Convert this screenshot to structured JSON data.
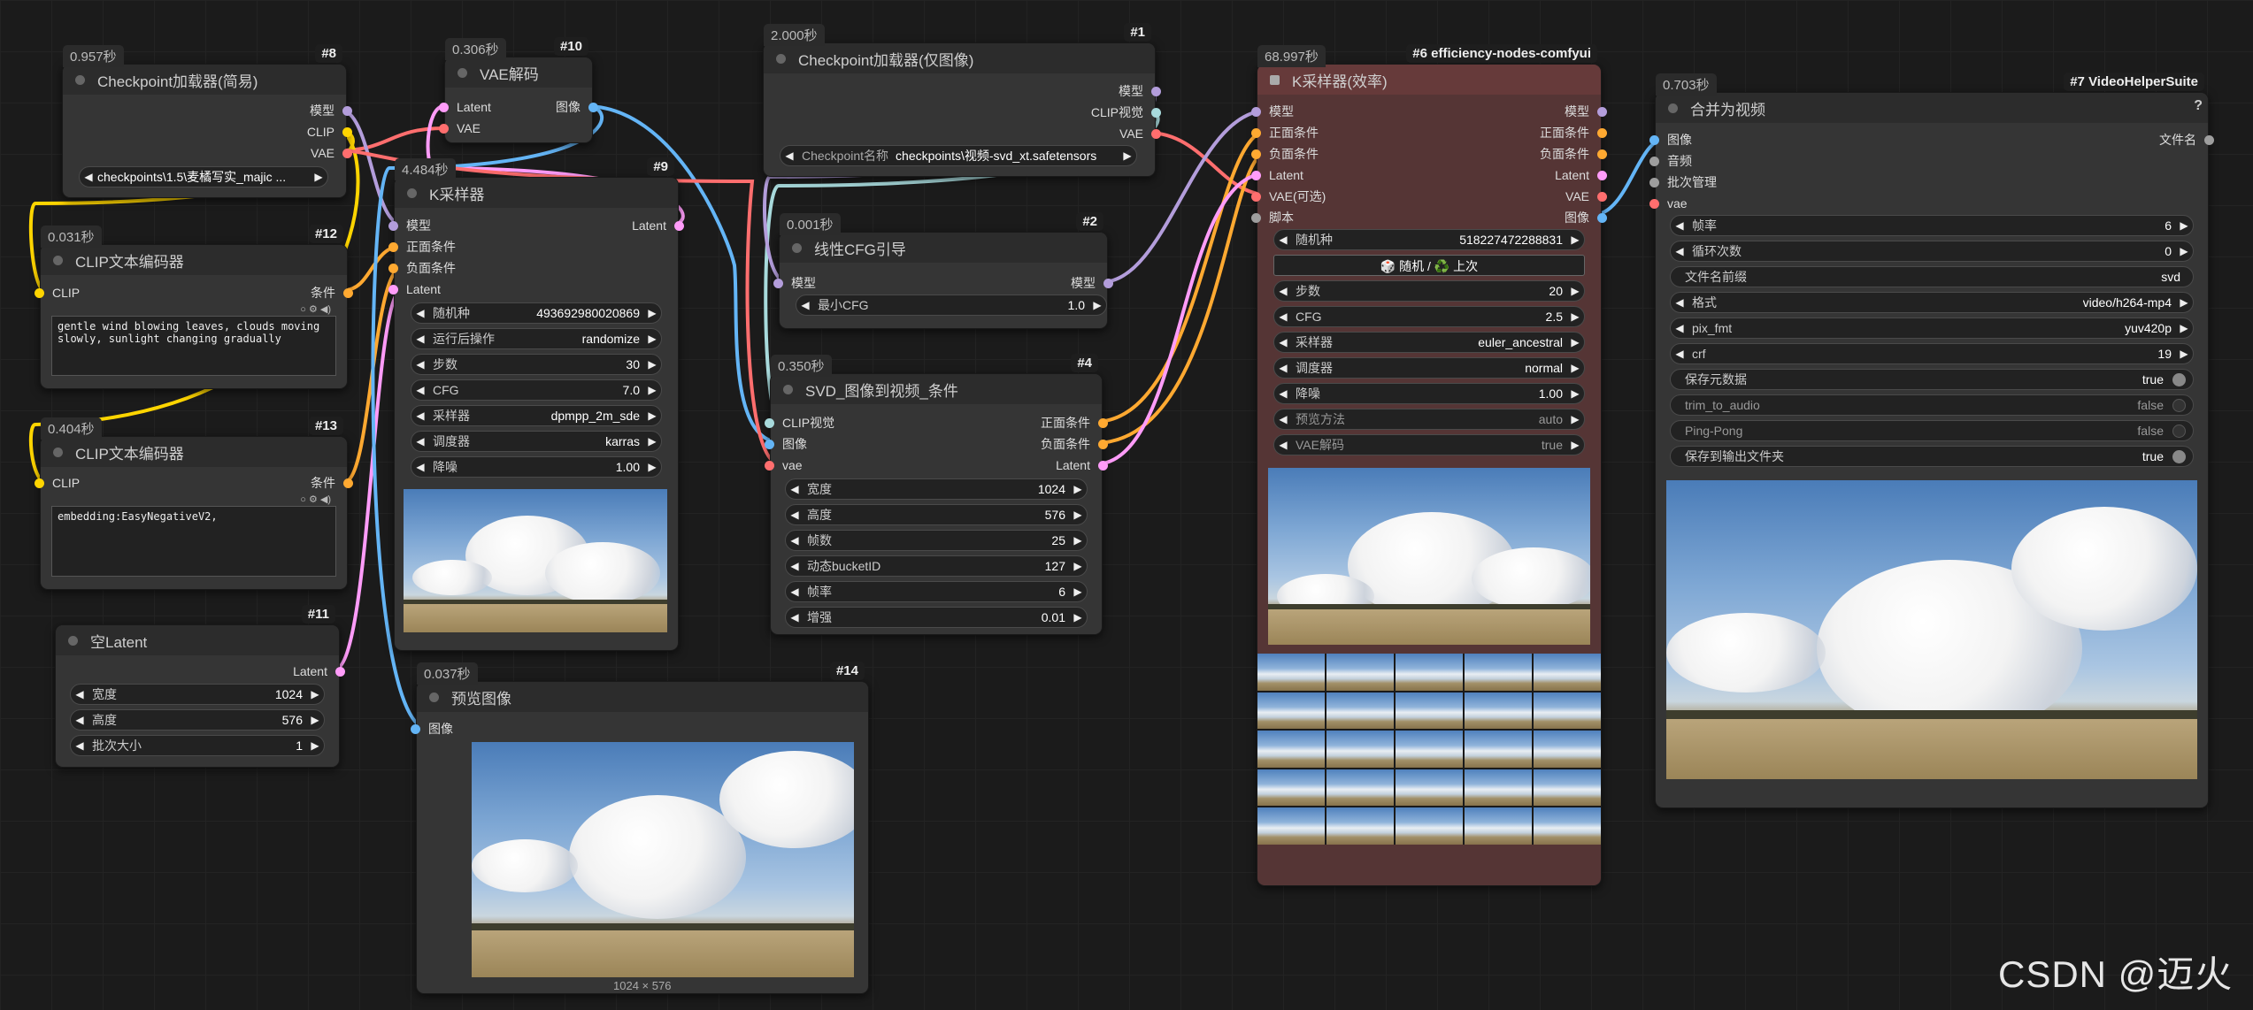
{
  "nodes": {
    "n8": {
      "time": "0.957秒",
      "id": "#8",
      "title": "Checkpoint加载器(简易)",
      "out_model": "模型",
      "out_clip": "CLIP",
      "out_vae": "VAE",
      "ckpt": "checkpoints\\1.5\\麦橘写实_majic ..."
    },
    "n10": {
      "time": "0.306秒",
      "id": "#10",
      "title": "VAE解码",
      "in_latent": "Latent",
      "in_vae": "VAE",
      "out_image": "图像"
    },
    "n12": {
      "time": "0.031秒",
      "id": "#12",
      "title": "CLIP文本编码器",
      "in_clip": "CLIP",
      "out_cond": "条件",
      "text": "gentle wind blowing leaves, clouds moving slowly, sunlight changing gradually"
    },
    "n13": {
      "time": "0.404秒",
      "id": "#13",
      "title": "CLIP文本编码器",
      "in_clip": "CLIP",
      "out_cond": "条件",
      "text": "embedding:EasyNegativeV2,"
    },
    "n11": {
      "id": "#11",
      "title": "空Latent",
      "out_latent": "Latent",
      "w_width": "宽度",
      "v_width": "1024",
      "w_height": "高度",
      "v_height": "576",
      "w_batch": "批次大小",
      "v_batch": "1"
    },
    "n9": {
      "time": "4.484秒",
      "id": "#9",
      "title": "K采样器",
      "in_model": "模型",
      "in_pos": "正面条件",
      "in_neg": "负面条件",
      "in_latent": "Latent",
      "out_latent": "Latent",
      "w_seed": "随机种",
      "v_seed": "493692980020869",
      "w_after": "运行后操作",
      "v_after": "randomize",
      "w_steps": "步数",
      "v_steps": "30",
      "w_cfg": "CFG",
      "v_cfg": "7.0",
      "w_sampler": "采样器",
      "v_sampler": "dpmpp_2m_sde",
      "w_sched": "调度器",
      "v_sched": "karras",
      "w_denoise": "降噪",
      "v_denoise": "1.00"
    },
    "n14": {
      "time": "0.037秒",
      "id": "#14",
      "title": "预览图像",
      "in_image": "图像",
      "caption": "1024 × 576"
    },
    "n1": {
      "time": "2.000秒",
      "id": "#1",
      "title": "Checkpoint加载器(仅图像)",
      "out_model": "模型",
      "out_clipv": "CLIP视觉",
      "out_vae": "VAE",
      "w_ckpt": "Checkpoint名称",
      "v_ckpt": "checkpoints\\视频-svd_xt.safetensors"
    },
    "n2": {
      "time": "0.001秒",
      "id": "#2",
      "title": "线性CFG引导",
      "in_model": "模型",
      "out_model": "模型",
      "w_mincfg": "最小CFG",
      "v_mincfg": "1.0"
    },
    "n4": {
      "time": "0.350秒",
      "id": "#4",
      "title": "SVD_图像到视频_条件",
      "in_clipv": "CLIP视觉",
      "in_image": "图像",
      "in_vae": "vae",
      "out_pos": "正面条件",
      "out_neg": "负面条件",
      "out_latent": "Latent",
      "w_width": "宽度",
      "v_width": "1024",
      "w_height": "高度",
      "v_height": "576",
      "w_frames": "帧数",
      "v_frames": "25",
      "w_bucket": "动态bucketID",
      "v_bucket": "127",
      "w_fps": "帧率",
      "v_fps": "6",
      "w_aug": "增强",
      "v_aug": "0.01"
    },
    "n6": {
      "time": "68.997秒",
      "id": "#6 efficiency-nodes-comfyui",
      "title": "K采样器(效率)",
      "in_model": "模型",
      "in_pos": "正面条件",
      "in_neg": "负面条件",
      "in_latent": "Latent",
      "in_vae": "VAE(可选)",
      "in_script": "脚本",
      "out_model": "模型",
      "out_pos": "正面条件",
      "out_neg": "负面条件",
      "out_latent": "Latent",
      "out_vae": "VAE",
      "out_image": "图像",
      "w_seed": "随机种",
      "v_seed": "518227472288831",
      "btn_rand": "🎲 随机 / ♻️ 上次",
      "w_steps": "步数",
      "v_steps": "20",
      "w_cfg": "CFG",
      "v_cfg": "2.5",
      "w_sampler": "采样器",
      "v_sampler": "euler_ancestral",
      "w_sched": "调度器",
      "v_sched": "normal",
      "w_denoise": "降噪",
      "v_denoise": "1.00",
      "w_preview": "预览方法",
      "v_preview": "auto",
      "w_vaedec": "VAE解码",
      "v_vaedec": "true"
    },
    "n7": {
      "time": "0.703秒",
      "id": "#7 VideoHelperSuite",
      "title": "合并为视频",
      "help": "?",
      "in_images": "图像",
      "in_audio": "音频",
      "in_batch": "批次管理",
      "in_vae": "vae",
      "out_filenames": "文件名",
      "w_fps": "帧率",
      "v_fps": "6",
      "w_loop": "循环次数",
      "v_loop": "0",
      "w_prefix": "文件名前缀",
      "v_prefix": "svd",
      "w_format": "格式",
      "v_format": "video/h264-mp4",
      "w_pix": "pix_fmt",
      "v_pix": "yuv420p",
      "w_crf": "crf",
      "v_crf": "19",
      "w_meta": "保存元数据",
      "v_meta": "true",
      "w_trim": "trim_to_audio",
      "v_trim": "false",
      "w_pp": "Ping-Pong",
      "v_pp": "false",
      "w_save": "保存到输出文件夹",
      "v_save": "true"
    }
  },
  "colors": {
    "model": "#b39ddb",
    "clip": "#ffd500",
    "vae": "#ff6e6e",
    "cond": "#ffa931",
    "latent": "#ff9cf9",
    "image": "#64b5f6",
    "clipvision": "#a8dadc",
    "grey": "#9e9e9e"
  },
  "watermark": "CSDN @迈火"
}
